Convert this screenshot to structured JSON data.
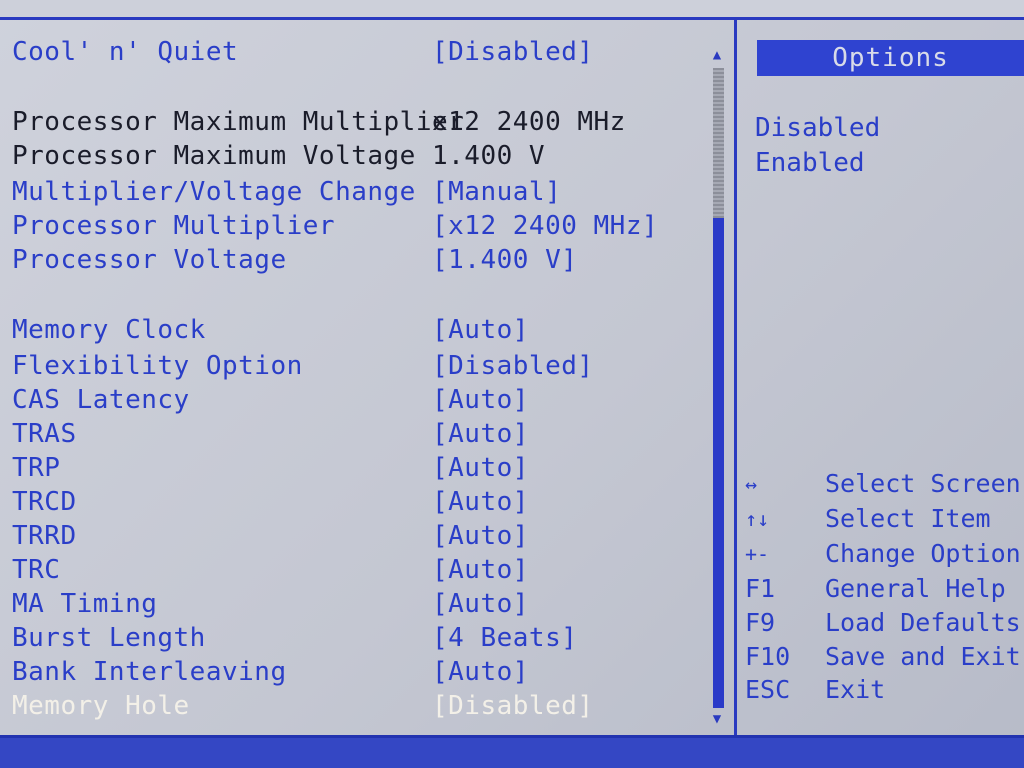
{
  "settings": [
    {
      "label": "Cool' n' Quiet",
      "value": "[Disabled]",
      "style": "editable"
    },
    {
      "label": "Processor Maximum Multiplier",
      "value": "x12 2400 MHz",
      "style": "static"
    },
    {
      "label": "Processor Maximum Voltage",
      "value": "1.400 V",
      "style": "static"
    },
    {
      "label": "Multiplier/Voltage Change",
      "value": "[Manual]",
      "style": "editable"
    },
    {
      "label": "Processor Multiplier",
      "value": "[x12 2400 MHz]",
      "style": "editable"
    },
    {
      "label": "Processor Voltage",
      "value": "[1.400 V]",
      "style": "editable"
    },
    {
      "label": "Memory Clock",
      "value": "[Auto]",
      "style": "editable"
    },
    {
      "label": "Flexibility Option",
      "value": "[Disabled]",
      "style": "editable"
    },
    {
      "label": "CAS Latency",
      "value": "[Auto]",
      "style": "editable"
    },
    {
      "label": "TRAS",
      "value": "[Auto]",
      "style": "editable"
    },
    {
      "label": "TRP",
      "value": "[Auto]",
      "style": "editable"
    },
    {
      "label": "TRCD",
      "value": "[Auto]",
      "style": "editable"
    },
    {
      "label": "TRRD",
      "value": "[Auto]",
      "style": "editable"
    },
    {
      "label": "TRC",
      "value": "[Auto]",
      "style": "editable"
    },
    {
      "label": "MA Timing",
      "value": "[Auto]",
      "style": "editable"
    },
    {
      "label": "Burst Length",
      "value": "[4 Beats]",
      "style": "editable"
    },
    {
      "label": "Bank Interleaving",
      "value": "[Auto]",
      "style": "editable"
    },
    {
      "label": "Memory Hole",
      "value": "[Disabled]",
      "style": "selected"
    }
  ],
  "options_panel": {
    "title": "Options",
    "items": [
      "Disabled",
      "Enabled"
    ]
  },
  "key_help": [
    {
      "key": "↔",
      "action": "Select Screen"
    },
    {
      "key": "↑↓",
      "action": "Select Item"
    },
    {
      "key": "+-",
      "action": "Change Option"
    },
    {
      "key": "F1",
      "action": "General Help"
    },
    {
      "key": "F9",
      "action": "Load Defaults"
    },
    {
      "key": "F10",
      "action": "Save and Exit"
    },
    {
      "key": "ESC",
      "action": "Exit"
    }
  ],
  "scrollbar": {
    "up_arrow": "▲",
    "down_arrow": "▼"
  },
  "colors": {
    "accent_blue": "#2a3ec8",
    "header_blue": "#2f43d0",
    "background": "#c4c7d2",
    "highlight_text": "#f3f0e8"
  }
}
